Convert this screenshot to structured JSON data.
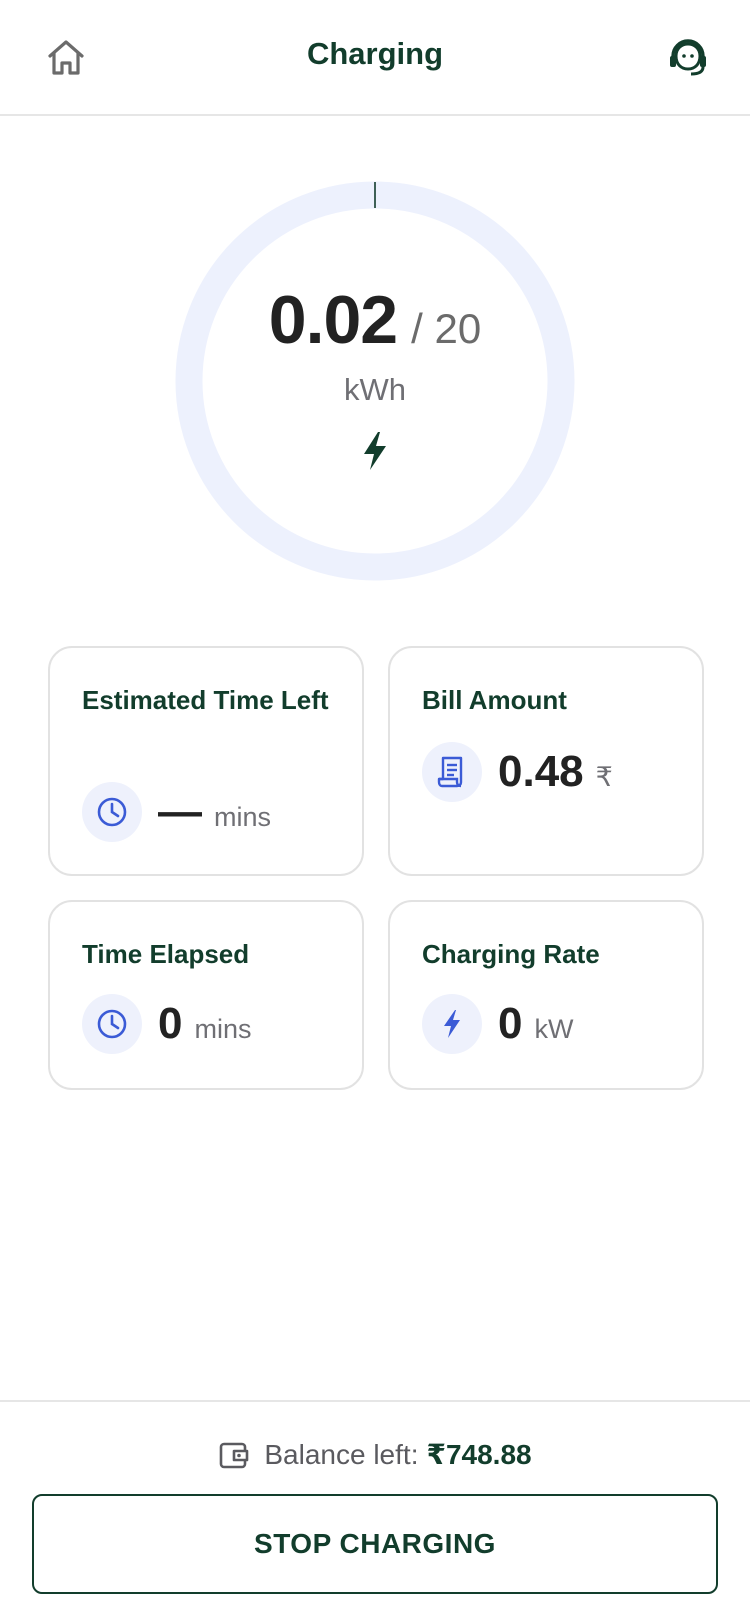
{
  "header": {
    "title": "Charging",
    "home_icon": "home-icon",
    "support_icon": "headset-support-icon"
  },
  "gauge": {
    "energy_value": "0.02",
    "energy_limit": "/ 20",
    "unit": "kWh",
    "progress": 0.001,
    "track_color": "#edf1fd",
    "indicator_color": "#123d2c",
    "bolt_icon": "bolt-icon"
  },
  "cards": {
    "estimated_time": {
      "label": "Estimated Time Left",
      "value": "—",
      "unit": "mins",
      "icon": "clock-icon"
    },
    "bill_amount": {
      "label": "Bill Amount",
      "value": "0.48",
      "unit": "₹",
      "icon": "receipt-icon"
    },
    "time_elapsed": {
      "label": "Time Elapsed",
      "value": "0",
      "unit": "mins",
      "icon": "clock-icon"
    },
    "charging_rate": {
      "label": "Charging Rate",
      "value": "0",
      "unit": "kW",
      "icon": "bolt-icon"
    }
  },
  "footer": {
    "balance_label": "Balance left:",
    "balance_amount": "₹748.88",
    "wallet_icon": "wallet-icon",
    "stop_label": "STOP CHARGING"
  },
  "colors": {
    "brand_dark_green": "#123d2c",
    "icon_blue": "#3b5bd6",
    "icon_bg": "#eef1fc"
  }
}
